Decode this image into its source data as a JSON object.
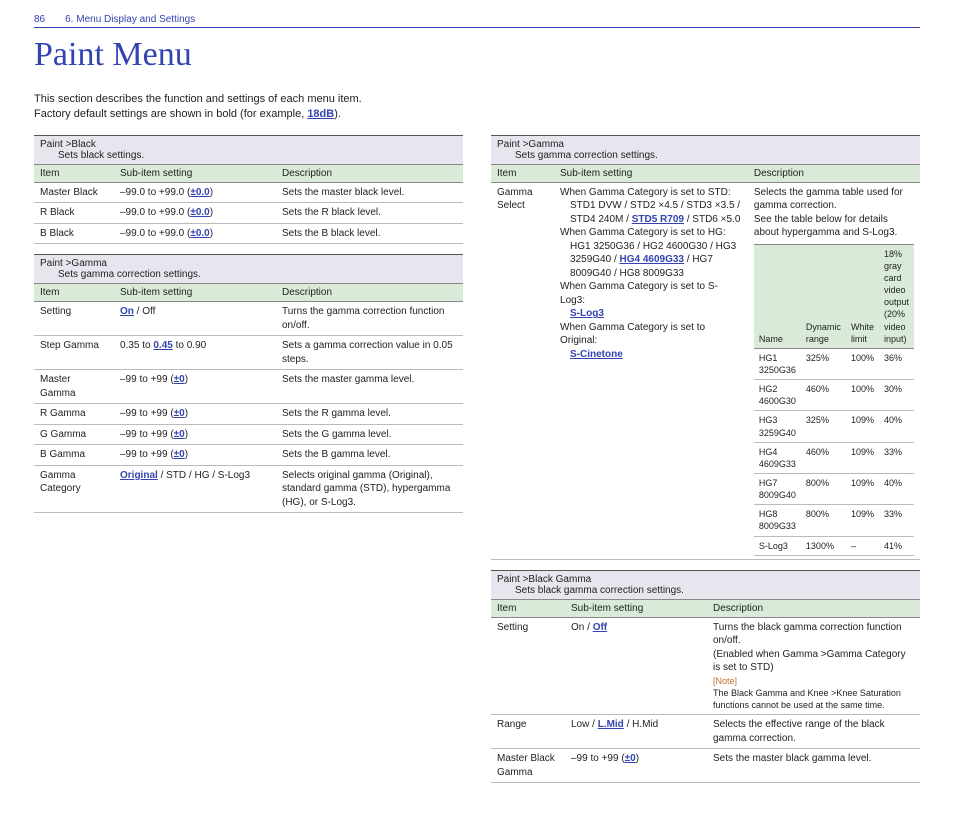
{
  "header": {
    "pageNo": "86",
    "crumb": "6. Menu Display and Settings"
  },
  "title": "Paint Menu",
  "intro": {
    "l1": "This section describes the function and settings of each menu item.",
    "l2a": "Factory default settings are shown in bold (for example, ",
    "l2b": "18dB",
    "l2c": ")."
  },
  "secBlack": {
    "title": "Paint >Black",
    "sub": "Sets black settings.",
    "hdr": {
      "a": "Item",
      "b": "Sub-item setting",
      "c": "Description"
    },
    "rows": [
      {
        "a": "Master Black",
        "b1": "–99.0 to +99.0 (",
        "b2": "±0.0",
        "b3": ")",
        "c": "Sets the master black level."
      },
      {
        "a": "R Black",
        "b1": "–99.0 to +99.0 (",
        "b2": "±0.0",
        "b3": ")",
        "c": "Sets the R black level."
      },
      {
        "a": "B Black",
        "b1": "–99.0 to +99.0 (",
        "b2": "±0.0",
        "b3": ")",
        "c": "Sets the B black level."
      }
    ]
  },
  "secGamma1": {
    "title": "Paint >Gamma",
    "sub": "Sets gamma correction settings.",
    "hdr": {
      "a": "Item",
      "b": "Sub-item setting",
      "c": "Description"
    },
    "rows": {
      "setting": {
        "a": "Setting",
        "on": "On",
        "off": " / Off",
        "c": "Turns the gamma correction function on/off."
      },
      "step": {
        "a": "Step Gamma",
        "b1": "0.35 to ",
        "b2": "0.45",
        "b3": " to 0.90",
        "c": "Sets a gamma correction value in 0.05 steps."
      },
      "master": {
        "a": "Master Gamma",
        "b1": "–99 to +99 (",
        "b2": "±0",
        "b3": ")",
        "c": "Sets the master gamma level."
      },
      "r": {
        "a": "R Gamma",
        "b1": "–99 to +99 (",
        "b2": "±0",
        "b3": ")",
        "c": "Sets the R gamma level."
      },
      "g": {
        "a": "G Gamma",
        "b1": "–99 to +99 (",
        "b2": "±0",
        "b3": ")",
        "c": "Sets the G gamma level."
      },
      "b": {
        "a": "B Gamma",
        "b1": "–99 to +99 (",
        "b2": "±0",
        "b3": ")",
        "c": "Sets the B gamma level."
      },
      "cat": {
        "a": "Gamma Category",
        "orig": "Original",
        "rest": " / STD / HG / S-Log3",
        "c": "Selects original gamma (Original), standard gamma (STD), hypergamma (HG), or S-Log3."
      }
    }
  },
  "secGamma2": {
    "title": "Paint >Gamma",
    "sub": "Sets gamma correction settings.",
    "hdr": {
      "a": "Item",
      "b": "Sub-item setting",
      "c": "Description"
    },
    "select": {
      "item": "Gamma Select",
      "l1": "When Gamma Category is set to STD:",
      "l2a": "STD1 DVW / STD2 ×4.5 / STD3 ×3.5 / STD4 240M / ",
      "l2b": "STD5 R709",
      "l2c": " / STD6 ×5.0",
      "l3": "When Gamma Category is set to HG:",
      "l4a": "HG1 3250G36 / HG2 4600G30 / HG3 3259G40 / ",
      "l4b": "HG4 4609G33",
      "l4c": " / HG7 8009G40 / HG8 8009G33",
      "l5": "When Gamma Category is set to S-Log3:",
      "l5b": "S-Log3",
      "l6": "When Gamma Category is set to Original:",
      "l6b": "S-Cinetone",
      "desc1": "Selects the gamma table used for gamma correction.",
      "desc2": "See the table below for details about hypergamma and S-Log3."
    },
    "inner": {
      "h": {
        "name": "Name",
        "dr": "Dynamic range",
        "wl": "White limit",
        "g": "18% gray card video output (20% video input)"
      },
      "rows": [
        {
          "n": "HG1 3250G36",
          "d": "325%",
          "w": "100%",
          "g": "36%"
        },
        {
          "n": "HG2 4600G30",
          "d": "460%",
          "w": "100%",
          "g": "30%"
        },
        {
          "n": "HG3 3259G40",
          "d": "325%",
          "w": "109%",
          "g": "40%"
        },
        {
          "n": "HG4 4609G33",
          "d": "460%",
          "w": "109%",
          "g": "33%"
        },
        {
          "n": "HG7 8009G40",
          "d": "800%",
          "w": "109%",
          "g": "40%"
        },
        {
          "n": "HG8 8009G33",
          "d": "800%",
          "w": "109%",
          "g": "33%"
        },
        {
          "n": "S-Log3",
          "d": "1300%",
          "w": "–",
          "g": "41%"
        }
      ]
    }
  },
  "secBG": {
    "title": "Paint >Black Gamma",
    "sub": "Sets black gamma correction settings.",
    "hdr": {
      "a": "Item",
      "b": "Sub-item setting",
      "c": "Description"
    },
    "setting": {
      "a": "Setting",
      "b1": "On / ",
      "b2": "Off",
      "c1": "Turns the black gamma correction function on/off.",
      "c2": "(Enabled when Gamma >Gamma Category is set to STD)",
      "noteLabel": "[Note]",
      "note": "The Black Gamma and Knee >Knee Saturation functions cannot be used at the same time."
    },
    "range": {
      "a": "Range",
      "b1": "Low / ",
      "b2": "L.Mid",
      "b3": " / H.Mid",
      "c": "Selects the effective range of the black gamma correction."
    },
    "mbg": {
      "a": "Master Black Gamma",
      "b1": "–99 to +99 (",
      "b2": "±0",
      "b3": ")",
      "c": "Sets the master black gamma level."
    }
  }
}
